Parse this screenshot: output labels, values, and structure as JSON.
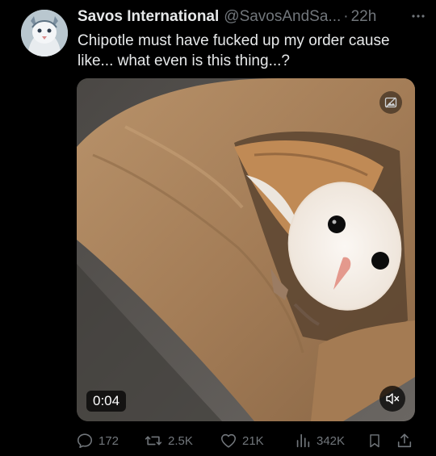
{
  "tweet": {
    "display_name": "Savos International",
    "handle": "@SavosAndSa...",
    "separator": "·",
    "time": "22h",
    "text": "Chipotle must have fucked up my order cause like... what even is this thing...?",
    "more_icon": "ellipsis-icon"
  },
  "media": {
    "type": "video",
    "duration": "0:04",
    "alt_icon": "picture-alt-icon",
    "mute_icon": "speaker-muted-icon"
  },
  "actions": {
    "replies": "172",
    "reposts": "2.5K",
    "likes": "21K",
    "views": "342K",
    "icons": [
      "reply-icon",
      "repost-icon",
      "like-icon",
      "views-icon",
      "bookmark-icon",
      "share-icon"
    ]
  },
  "colors": {
    "background": "#000000",
    "primary_text": "#e7e9ea",
    "secondary_text": "#71767b"
  }
}
